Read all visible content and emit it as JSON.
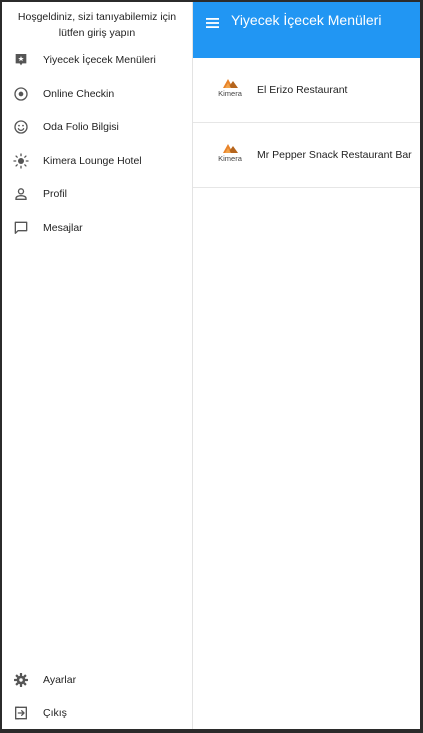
{
  "drawer": {
    "welcome": "Hoşgeldiniz, sizi tanıyabilemiz için lütfen giriş yapın",
    "items": [
      {
        "label": "Yiyecek İçecek Menüleri",
        "icon": "food-menu-icon"
      },
      {
        "label": "Online Checkin",
        "icon": "radio-target-icon"
      },
      {
        "label": "Oda Folio Bilgisi",
        "icon": "smiley-icon"
      },
      {
        "label": "Kimera Lounge Hotel",
        "icon": "sun-icon"
      },
      {
        "label": "Profil",
        "icon": "person-icon"
      },
      {
        "label": "Mesajlar",
        "icon": "chat-icon"
      }
    ],
    "bottom_items": [
      {
        "label": "Ayarlar",
        "icon": "gear-icon"
      },
      {
        "label": "Çıkış",
        "icon": "logout-icon"
      }
    ]
  },
  "appbar": {
    "title": "Yiyecek İçecek Menüleri",
    "color": "#2196f3"
  },
  "restaurants": [
    {
      "name": "El Erizo Restaurant",
      "logo_text": "Kimera"
    },
    {
      "name": "Mr Pepper Snack Restaurant Bar",
      "logo_text": "Kimera"
    }
  ]
}
